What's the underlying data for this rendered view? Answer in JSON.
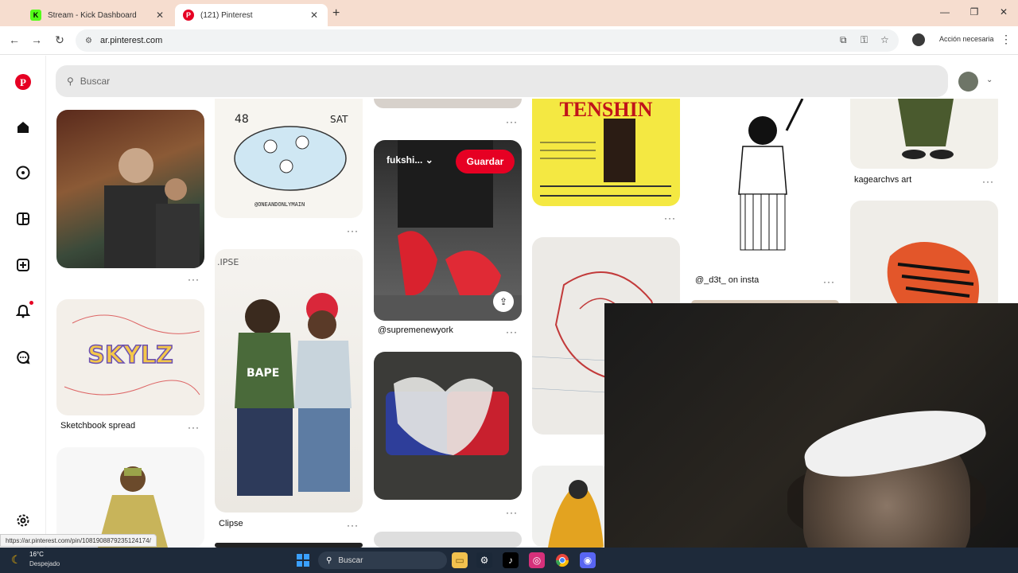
{
  "browser": {
    "tabs": [
      {
        "label": "Stream - Kick Dashboard",
        "favicon": "kick-icon",
        "active": false
      },
      {
        "label": "(121) Pinterest",
        "favicon": "pinterest-icon",
        "active": true
      }
    ],
    "url": "ar.pinterest.com",
    "action_label": "Acción necesaria",
    "status_url": "https://ar.pinterest.com/pin/1081908879235124174/"
  },
  "pinterest": {
    "search_placeholder": "Buscar",
    "sidebar_icons": [
      "pinterest-logo-icon",
      "home-icon",
      "explore-icon",
      "boards-icon",
      "create-icon",
      "notifications-icon",
      "messages-icon",
      "settings-icon"
    ],
    "hover_pin": {
      "board_label": "fukshi...",
      "save_label": "Guardar"
    },
    "pins": [
      {
        "caption": ""
      },
      {
        "caption": "Sketchbook spread"
      },
      {
        "caption": ""
      },
      {
        "caption": "Clipse"
      },
      {
        "caption": "@supremenewyork"
      },
      {
        "caption": ""
      },
      {
        "caption": ""
      },
      {
        "caption": ""
      },
      {
        "caption": "@_d3t_ on insta"
      },
      {
        "caption": "kagearchvs art"
      }
    ],
    "poster_title": "TENSHIN"
  },
  "taskbar": {
    "temperature": "16°C",
    "weather": "Despejado",
    "search_placeholder": "Buscar",
    "colors": {
      "accent": "#e60023",
      "taskbar": "#1e2a3a"
    }
  }
}
